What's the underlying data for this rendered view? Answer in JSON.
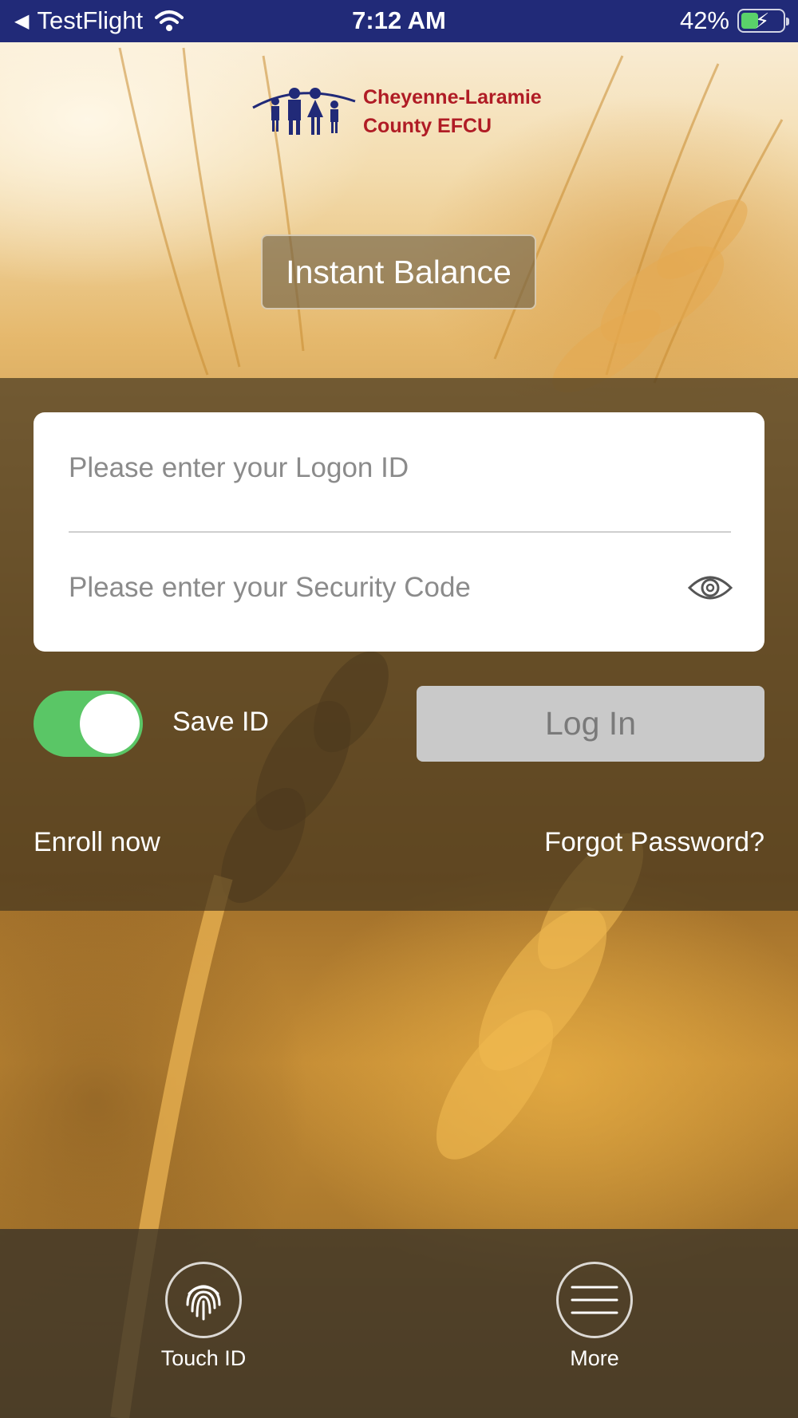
{
  "status_bar": {
    "back_app": "TestFlight",
    "time": "7:12 AM",
    "battery_percent": "42%",
    "battery_level": 0.42
  },
  "logo": {
    "line1": "Cheyenne-Laramie",
    "line2": "County EFCU",
    "brand_color": "#b01c25",
    "mark_color": "#212a78"
  },
  "instant_balance": {
    "label": "Instant Balance"
  },
  "login_form": {
    "logon_id_placeholder": "Please enter your Logon ID",
    "logon_id_value": "",
    "security_code_placeholder": "Please enter your Security Code",
    "security_code_value": "",
    "show_password_icon": "eye-icon"
  },
  "save_id": {
    "label": "Save ID",
    "enabled": true,
    "toggle_color": "#5ac666"
  },
  "login_button": {
    "label": "Log In"
  },
  "links": {
    "enroll": "Enroll now",
    "forgot_password": "Forgot Password?"
  },
  "bottom_bar": {
    "touch_id": {
      "label": "Touch ID",
      "icon": "fingerprint-icon"
    },
    "more": {
      "label": "More",
      "icon": "hamburger-menu-icon"
    }
  }
}
